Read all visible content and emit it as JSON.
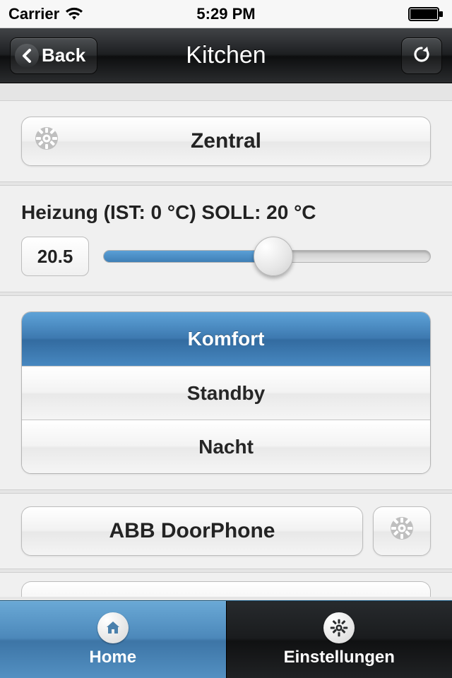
{
  "status": {
    "carrier": "Carrier",
    "time": "5:29 PM"
  },
  "nav": {
    "back_label": "Back",
    "title": "Kitchen"
  },
  "zentral": {
    "label": "Zentral"
  },
  "heating": {
    "label": "Heizung (IST: 0 °C) SOLL: 20 °C",
    "value": "20.5"
  },
  "modes": {
    "items": [
      {
        "label": "Komfort",
        "selected": true
      },
      {
        "label": "Standby",
        "selected": false
      },
      {
        "label": "Nacht",
        "selected": false
      }
    ]
  },
  "doorphone": {
    "label": "ABB DoorPhone"
  },
  "tabs": {
    "home": "Home",
    "settings": "Einstellungen"
  }
}
